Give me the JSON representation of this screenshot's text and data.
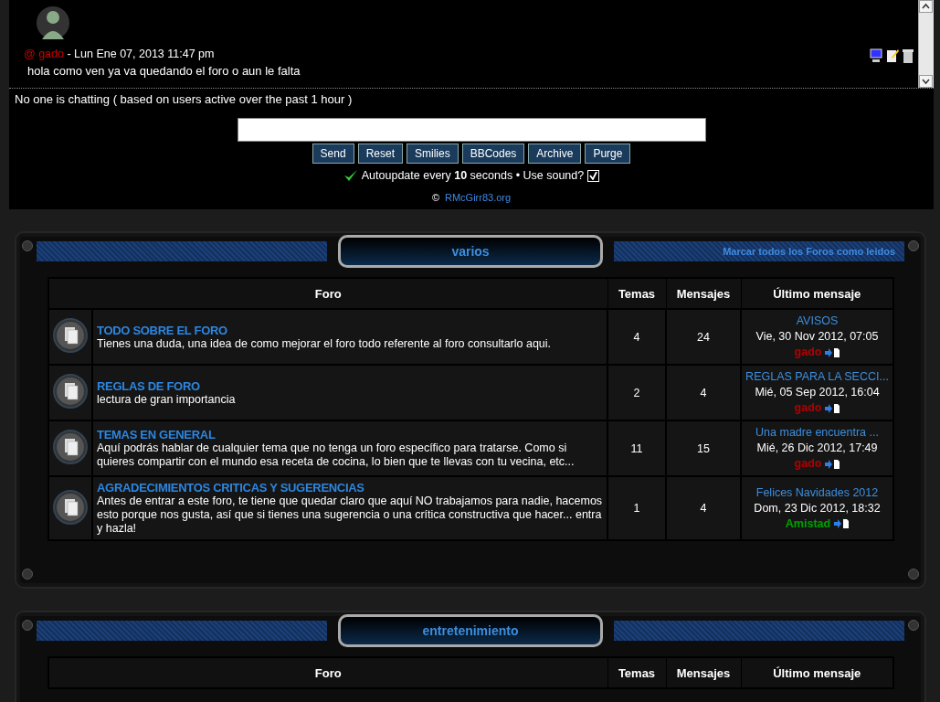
{
  "chat": {
    "messages": [
      {
        "author": "@ gado",
        "meta": " - Lun Ene 07, 2013 11:47 pm",
        "text": "hola como ven ya va quedando el foro o aun le falta"
      }
    ],
    "status": "No one is chatting ( based on users active over the past 1 hour )",
    "buttons": [
      "Send",
      "Reset",
      "Smilies",
      "BBCodes",
      "Archive",
      "Purge"
    ],
    "autoupdate": "Autoupdate every **10** seconds • Use sound?",
    "sound_checked": true,
    "credit_symbol": "©",
    "credit_link": "RMcGirr83.org"
  },
  "categories": [
    {
      "title": "varios",
      "mark_read_link": "Marcar todos los Foros como leidos",
      "columns": [
        "Foro",
        "Temas",
        "Mensajes",
        "Último mensaje"
      ],
      "forums": [
        {
          "name": "TODO SOBRE EL FORO",
          "description": "Tienes una duda, una idea de como mejorar el foro todo referente al foro consultarlo aqui.",
          "topics": "4",
          "posts": "24",
          "last_title": "AVISOS",
          "last_date": "Vie, 30 Nov 2012, 07:05",
          "last_author": "gado",
          "color": "#b30000"
        },
        {
          "name": "REGLAS DE FORO",
          "description": "lectura de gran importancia",
          "topics": "2",
          "posts": "4",
          "last_title": "REGLAS PARA LA SECCI...",
          "last_date": "Mié, 05 Sep 2012, 16:04",
          "last_author": "gado",
          "color": "#b30000"
        },
        {
          "name": "TEMAS EN GENERAL",
          "description": "Aquí podrás hablar de cualquier tema que no tenga un foro específico para tratarse. Como si quieres compartir con el mundo esa receta de cocina, lo bien que te llevas con tu vecina, etc...",
          "topics": "11",
          "posts": "15",
          "last_title": "Una madre encuentra ...",
          "last_date": "Mié, 26 Dic 2012, 17:49",
          "last_author": "gado",
          "color": "#b30000"
        },
        {
          "name": "AGRADECIMIENTOS CRITICAS Y SUGERENCIAS",
          "description": "Antes de entrar a este foro, te tiene que quedar claro que aquí NO trabajamos para nadie, hacemos esto porque nos gusta, así que si tienes una sugerencia o una crítica constructiva que hacer... entra y hazla!",
          "topics": "1",
          "posts": "4",
          "last_title": "Felices Navidades 2012",
          "last_date": "Dom, 23 Dic 2012, 18:32",
          "last_author": "Amistad",
          "color": "#00a000"
        }
      ]
    },
    {
      "title": "entretenimiento",
      "columns": [
        "Foro",
        "Temas",
        "Mensajes",
        "Último mensaje"
      ]
    }
  ]
}
